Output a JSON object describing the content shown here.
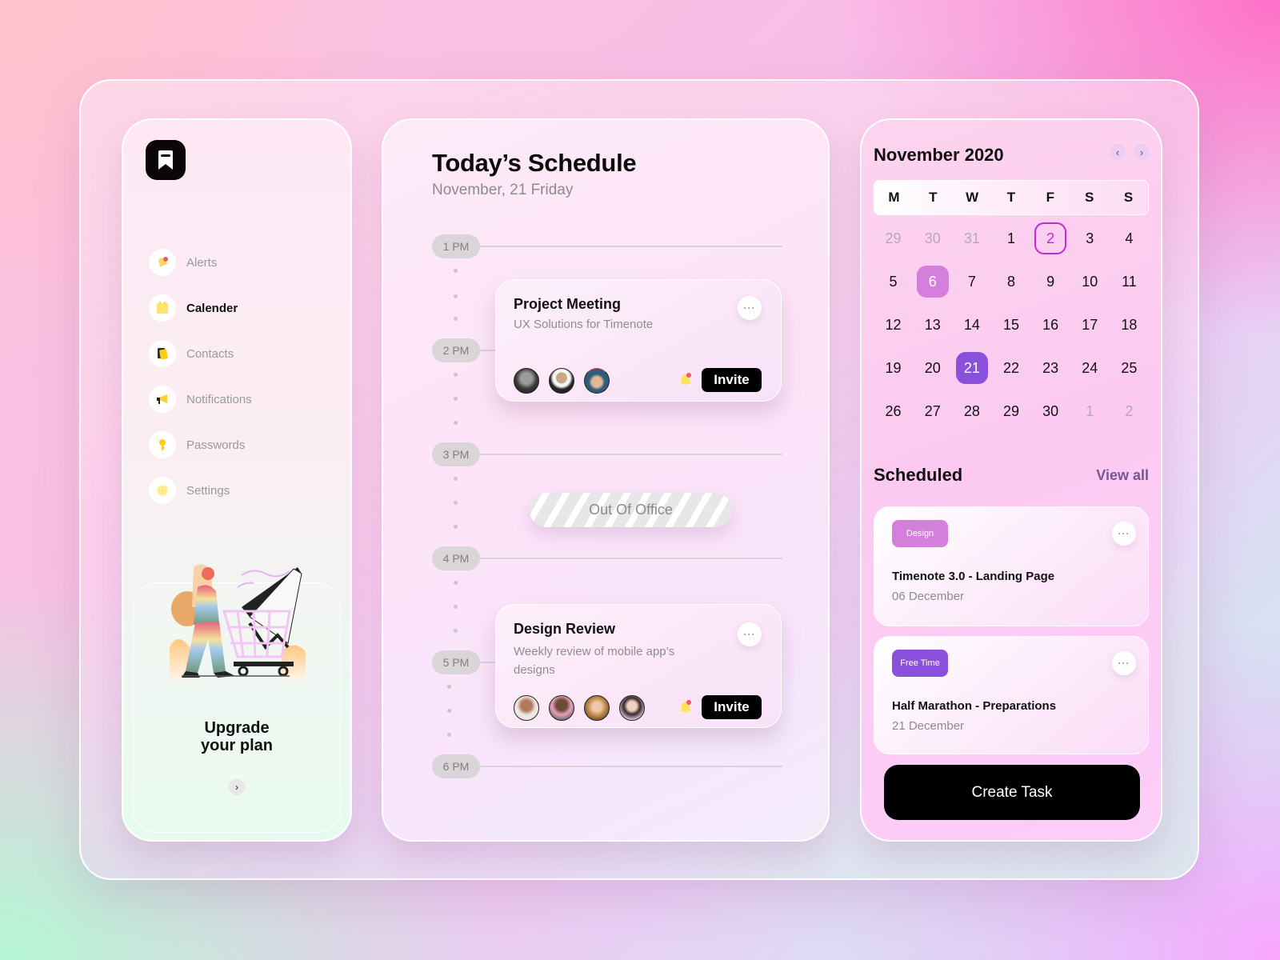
{
  "app": {
    "logo": "bookmark-logo-icon"
  },
  "sidebar": {
    "items": [
      {
        "label": "Alerts",
        "icon": "bell-icon",
        "active": false
      },
      {
        "label": "Calender",
        "icon": "calendar-icon",
        "active": true
      },
      {
        "label": "Contacts",
        "icon": "contacts-icon",
        "active": false
      },
      {
        "label": "Notifications",
        "icon": "megaphone-icon",
        "active": false
      },
      {
        "label": "Passwords",
        "icon": "key-icon",
        "active": false
      },
      {
        "label": "Settings",
        "icon": "gear-icon",
        "active": false
      }
    ],
    "upgrade": {
      "line1": "Upgrade",
      "line2": "your plan",
      "arrow": "›"
    }
  },
  "schedule": {
    "title": "Today’s Schedule",
    "date": "November, 21 Friday",
    "hours": [
      "1 PM",
      "2 PM",
      "3 PM",
      "4 PM",
      "5 PM",
      "6 PM"
    ],
    "events": [
      {
        "title": "Project Meeting",
        "description": "UX Solutions for Timenote",
        "attendees": 3,
        "invite_label": "Invite",
        "more": "···"
      },
      {
        "title": "Design Review",
        "description": "Weekly review of mobile app’s designs",
        "attendees": 4,
        "invite_label": "Invite",
        "more": "···"
      }
    ],
    "out_of_office": "Out Of Office"
  },
  "calendar": {
    "month_label": "November 2020",
    "prev": "‹",
    "next": "›",
    "weekdays": [
      "M",
      "T",
      "W",
      "T",
      "F",
      "S",
      "S"
    ],
    "weeks": [
      [
        "29",
        "30",
        "31",
        "1",
        "2",
        "3",
        "4"
      ],
      [
        "5",
        "6",
        "7",
        "8",
        "9",
        "10",
        "11"
      ],
      [
        "12",
        "13",
        "14",
        "15",
        "16",
        "17",
        "18"
      ],
      [
        "19",
        "20",
        "21",
        "22",
        "23",
        "24",
        "25"
      ],
      [
        "26",
        "27",
        "28",
        "29",
        "30",
        "1",
        "2"
      ]
    ],
    "muted_days": [
      "0-0",
      "0-1",
      "0-2",
      "4-5",
      "4-6"
    ],
    "outlined_day": "2",
    "highlighted_day": "6",
    "selected_day": "21",
    "colors": {
      "outlined": "#c627d8",
      "highlighted": "#d57fdc",
      "selected": "#8a4fdb"
    }
  },
  "scheduled": {
    "title": "Scheduled",
    "view_all": "View all",
    "tasks": [
      {
        "tag": "Design",
        "tag_color": "#d57fdc",
        "title": "Timenote 3.0 - Landing Page",
        "date": "06 December",
        "more": "···"
      },
      {
        "tag": "Free Time",
        "tag_color": "#8a4fdb",
        "title": "Half Marathon - Preparations",
        "date": "21 December",
        "more": "···"
      }
    ],
    "create_label": "Create Task"
  }
}
